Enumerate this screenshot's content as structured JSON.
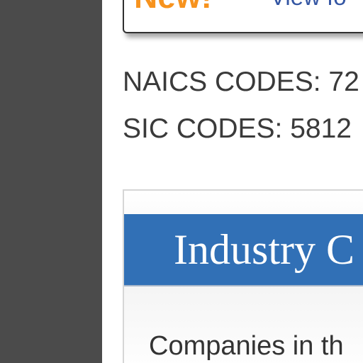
{
  "banner": {
    "new_label": "New!",
    "link_text": "View fo"
  },
  "codes": {
    "naics": "NAICS CODES: 72",
    "sic": "SIC CODES: 5812"
  },
  "industry_panel": {
    "title": "Industry C",
    "body": "Companies in th"
  },
  "colors": {
    "left_rail": "#4b4b4b",
    "new_orange": "#f7931e",
    "link_blue": "#3456a3",
    "panel_header_blue": "#3170b6"
  }
}
